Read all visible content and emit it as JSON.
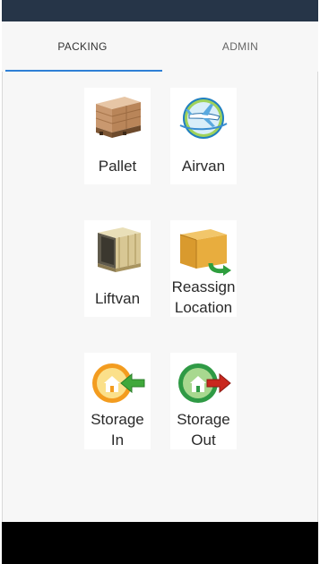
{
  "tabs": [
    {
      "label": "PACKING",
      "active": true
    },
    {
      "label": "ADMIN",
      "active": false
    }
  ],
  "tiles": [
    {
      "line1": "Pallet",
      "line2": "",
      "icon": "pallet-icon"
    },
    {
      "line1": "Airvan",
      "line2": "",
      "icon": "airplane-icon"
    },
    {
      "line1": "Liftvan",
      "line2": "",
      "icon": "liftvan-crate-icon"
    },
    {
      "line1": "Reassign",
      "line2": "Location",
      "icon": "box-reassign-icon"
    },
    {
      "line1": "Storage",
      "line2": "In",
      "icon": "storage-in-icon"
    },
    {
      "line1": "Storage",
      "line2": "Out",
      "icon": "storage-out-icon"
    }
  ],
  "colors": {
    "status_bar": "#263548",
    "tab_indicator": "#2f80d6",
    "bottom_bar": "#000000"
  }
}
